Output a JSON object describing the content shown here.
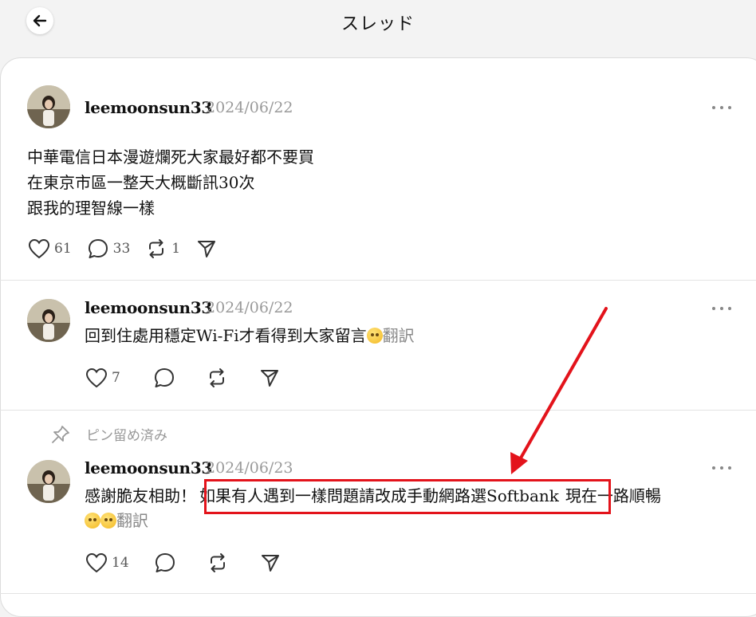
{
  "header": {
    "title": "スレッド"
  },
  "posts": [
    {
      "username": "leemoonsun33",
      "date": "2024/06/22",
      "lines": [
        "中華電信日本漫遊爛死大家最好都不要買",
        "在東京市區一整天大概斷訊30次",
        "跟我的理智線一樣"
      ],
      "likes": "61",
      "comments": "33",
      "reposts": "1"
    },
    {
      "username": "leemoonsun33",
      "date": "2024/06/22",
      "text": "回到住處用穩定Wi-Fi才看得到大家留言",
      "translate": "翻訳",
      "likes": "7"
    },
    {
      "pinned_label": "ピン留め済み",
      "username": "leemoonsun33",
      "date": "2024/06/23",
      "text_part1": "感謝脆友相助！",
      "text_highlight": "如果有人遇到一樣問題請改成手動網路選Softbank",
      "text_part2": "現在一路順暢",
      "translate": "翻訳",
      "likes": "14"
    }
  ],
  "annotation": {
    "color": "#e3131b"
  }
}
